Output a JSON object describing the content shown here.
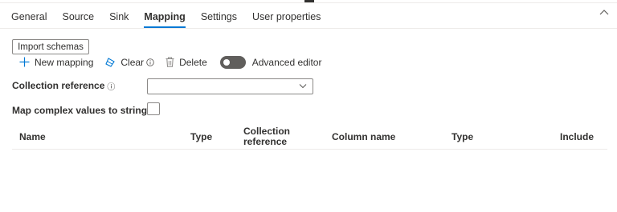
{
  "tabs": [
    {
      "label": "General"
    },
    {
      "label": "Source"
    },
    {
      "label": "Sink"
    },
    {
      "label": "Mapping",
      "active": true
    },
    {
      "label": "Settings"
    },
    {
      "label": "User properties"
    }
  ],
  "toolbar": {
    "import_schemas": "Import schemas",
    "new_mapping": "New mapping",
    "clear": "Clear",
    "delete": "Delete",
    "advanced_editor": "Advanced editor"
  },
  "form": {
    "collection_reference_label": "Collection reference",
    "collection_reference_value": "",
    "map_complex_label": "Map complex values to string",
    "map_complex_checked": false
  },
  "grid": {
    "columns": [
      "Name",
      "Type",
      "Collection reference",
      "Column name",
      "Type",
      "Include"
    ]
  },
  "colors": {
    "accent": "#0078d4",
    "text": "#323130",
    "toggle_off": "#605e5c"
  }
}
